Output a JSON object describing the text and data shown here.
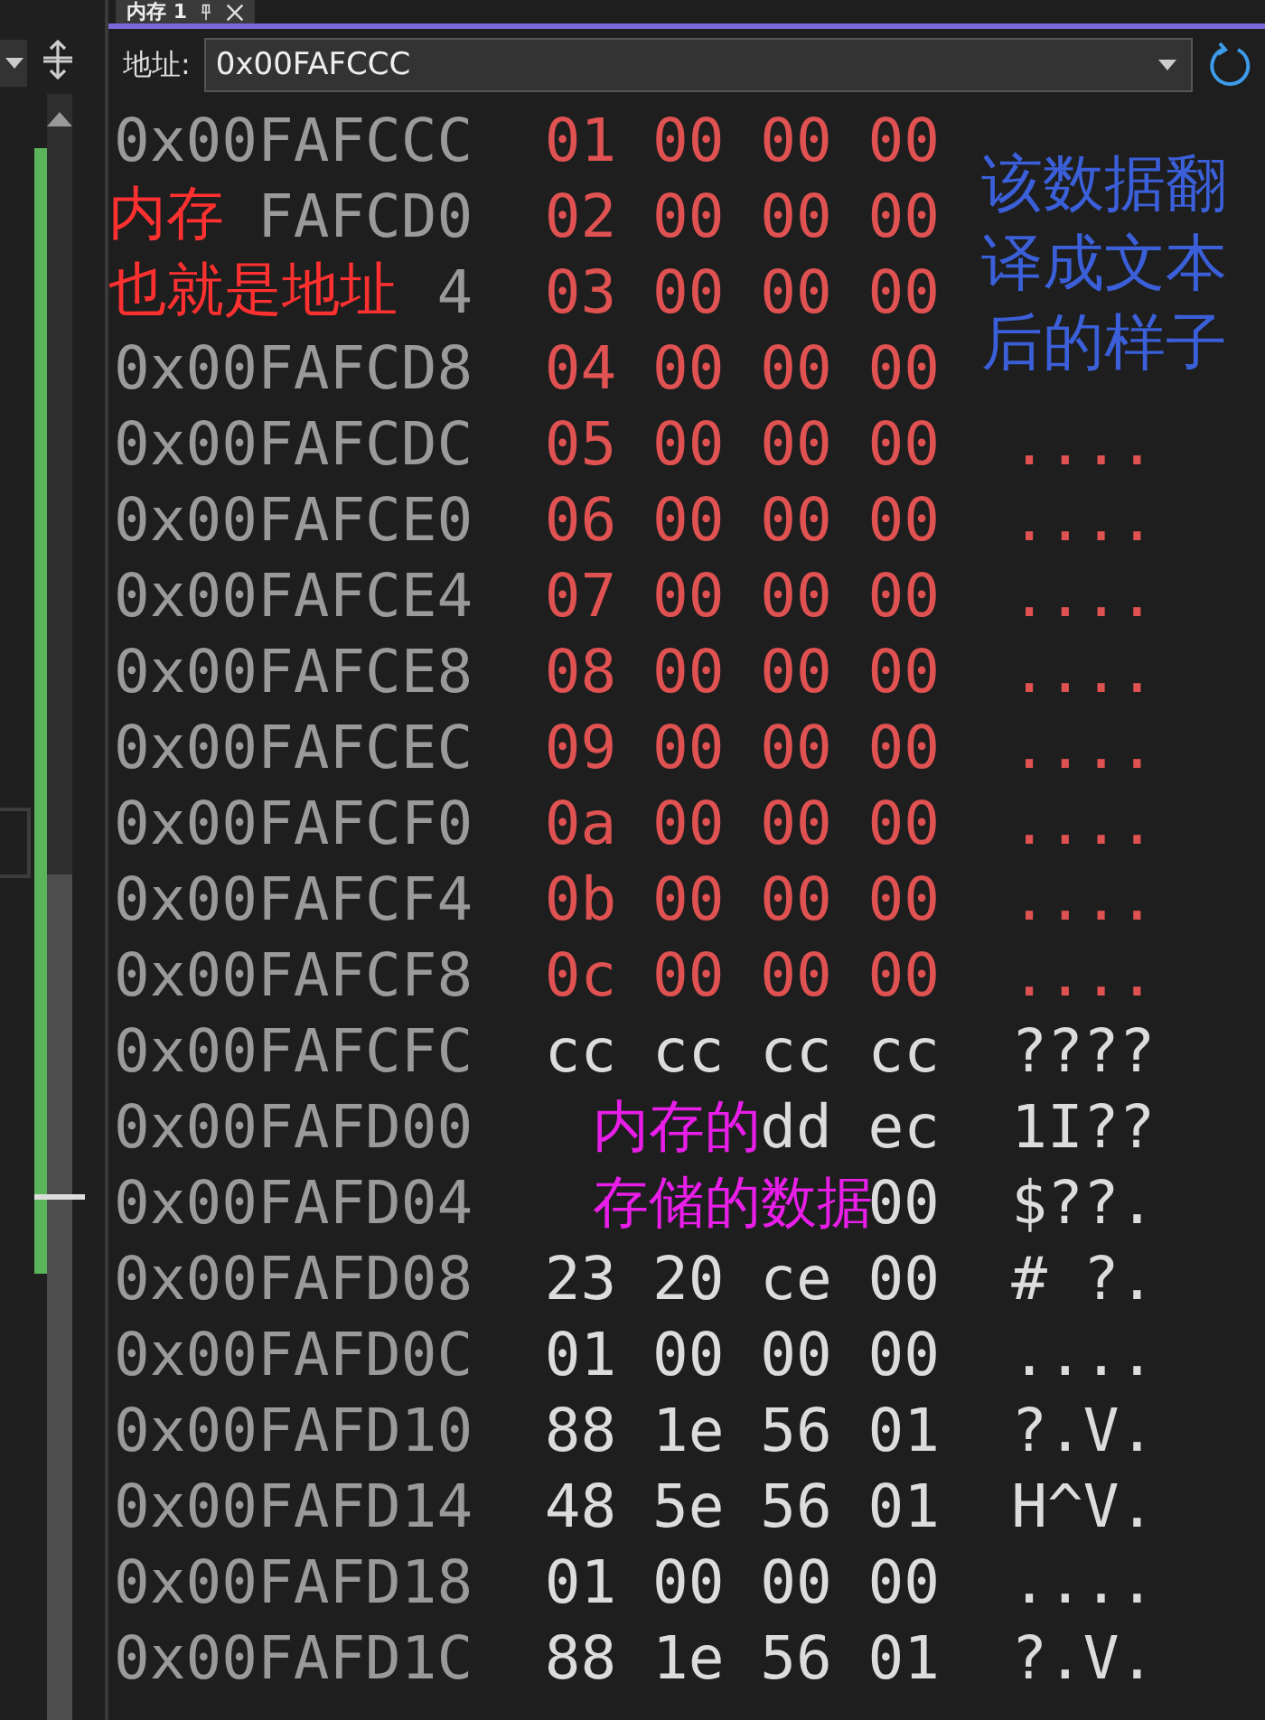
{
  "tab": {
    "title": "内存 1"
  },
  "address_bar": {
    "label": "地址:",
    "value": "0x00FAFCCC"
  },
  "rows": [
    {
      "address": "0x00FAFCCC",
      "bytes": [
        "01",
        "00",
        "00",
        "00"
      ],
      "changed": true
    },
    {
      "address": "FAFCD0",
      "bytes": [
        "02",
        "00",
        "00",
        "00"
      ],
      "changed": true
    },
    {
      "address": "4",
      "bytes": [
        "03",
        "00",
        "00",
        "00"
      ],
      "changed": true
    },
    {
      "address": "0x00FAFCD8",
      "bytes": [
        "04",
        "00",
        "00",
        "00"
      ],
      "changed": true
    },
    {
      "address": "0x00FAFCDC",
      "bytes": [
        "05",
        "00",
        "00",
        "00"
      ],
      "text": "....",
      "changed": true
    },
    {
      "address": "0x00FAFCE0",
      "bytes": [
        "06",
        "00",
        "00",
        "00"
      ],
      "text": "....",
      "changed": true
    },
    {
      "address": "0x00FAFCE4",
      "bytes": [
        "07",
        "00",
        "00",
        "00"
      ],
      "text": "....",
      "changed": true
    },
    {
      "address": "0x00FAFCE8",
      "bytes": [
        "08",
        "00",
        "00",
        "00"
      ],
      "text": "....",
      "changed": true
    },
    {
      "address": "0x00FAFCEC",
      "bytes": [
        "09",
        "00",
        "00",
        "00"
      ],
      "text": "....",
      "changed": true
    },
    {
      "address": "0x00FAFCF0",
      "bytes": [
        "0a",
        "00",
        "00",
        "00"
      ],
      "text": "....",
      "changed": true
    },
    {
      "address": "0x00FAFCF4",
      "bytes": [
        "0b",
        "00",
        "00",
        "00"
      ],
      "text": "....",
      "changed": true
    },
    {
      "address": "0x00FAFCF8",
      "bytes": [
        "0c",
        "00",
        "00",
        "00"
      ],
      "text": "....",
      "changed": true
    },
    {
      "address": "0x00FAFCFC",
      "bytes": [
        "cc",
        "cc",
        "cc",
        "cc"
      ],
      "text": "????",
      "changed": false
    },
    {
      "address": "0x00FAFD00",
      "bytes": [
        "dd",
        "ec"
      ],
      "text": "1I??",
      "changed": false
    },
    {
      "address": "0x00FAFD04",
      "bytes": [
        "00"
      ],
      "text": "$??.",
      "changed": false
    },
    {
      "address": "0x00FAFD08",
      "bytes": [
        "23",
        "20",
        "ce",
        "00"
      ],
      "text": "# ?.",
      "changed": false
    },
    {
      "address": "0x00FAFD0C",
      "bytes": [
        "01",
        "00",
        "00",
        "00"
      ],
      "text": "....",
      "changed": false
    },
    {
      "address": "0x00FAFD10",
      "bytes": [
        "88",
        "1e",
        "56",
        "01"
      ],
      "text": "?.V.",
      "changed": false
    },
    {
      "address": "0x00FAFD14",
      "bytes": [
        "48",
        "5e",
        "56",
        "01"
      ],
      "text": "H^V.",
      "changed": false
    },
    {
      "address": "0x00FAFD18",
      "bytes": [
        "01",
        "00",
        "00",
        "00"
      ],
      "text": "....",
      "changed": false
    },
    {
      "address": "0x00FAFD1C",
      "bytes": [
        "88",
        "1e",
        "56",
        "01"
      ],
      "text": "?.V.",
      "changed": false
    }
  ],
  "annotations": [
    {
      "kind": "address",
      "color": "#ff3030",
      "lines": [
        "内存",
        "也就是地址"
      ]
    },
    {
      "kind": "text",
      "color": "#3a5fd8",
      "lines": [
        "该数据翻",
        "译成文本",
        "后的样子"
      ]
    },
    {
      "kind": "data",
      "color": "#e81ee8",
      "lines": [
        "内存的",
        "存储的数据"
      ]
    }
  ]
}
